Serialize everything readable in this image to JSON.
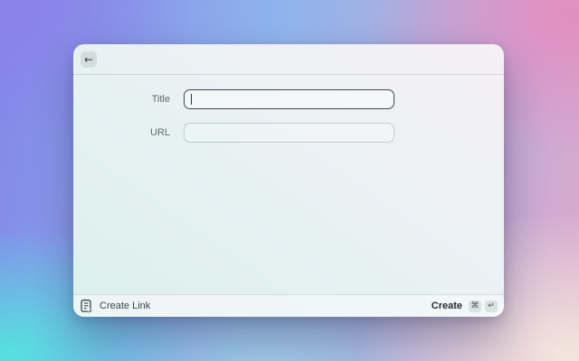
{
  "colors": {
    "background_mesh": {
      "top_left": "#8b82e8",
      "top_center": "#8fb4ec",
      "top_right": "#e48cc0",
      "left_middle": "#8287e8",
      "bottom_left": "#52e6de",
      "bottom_center": "#a0cfe6",
      "bottom_right": "#f4e8de"
    },
    "window_bg_top": "#f4f0f4",
    "window_bg_bottom": "#dcf0ec",
    "focused_input_border": "#3d474e",
    "unfocused_input_border": "#c3ccd1"
  },
  "icons": {
    "back": "←",
    "footer_app": "list-with-pencil",
    "command_key": "⌘",
    "return_key": "↵"
  },
  "form": {
    "fields": [
      {
        "label": "Title",
        "value": "",
        "focused": true
      },
      {
        "label": "URL",
        "value": "",
        "focused": false
      }
    ]
  },
  "footer": {
    "command_name": "Create Link",
    "primary_action": {
      "label": "Create",
      "keys": [
        "⌘",
        "↵"
      ]
    }
  }
}
